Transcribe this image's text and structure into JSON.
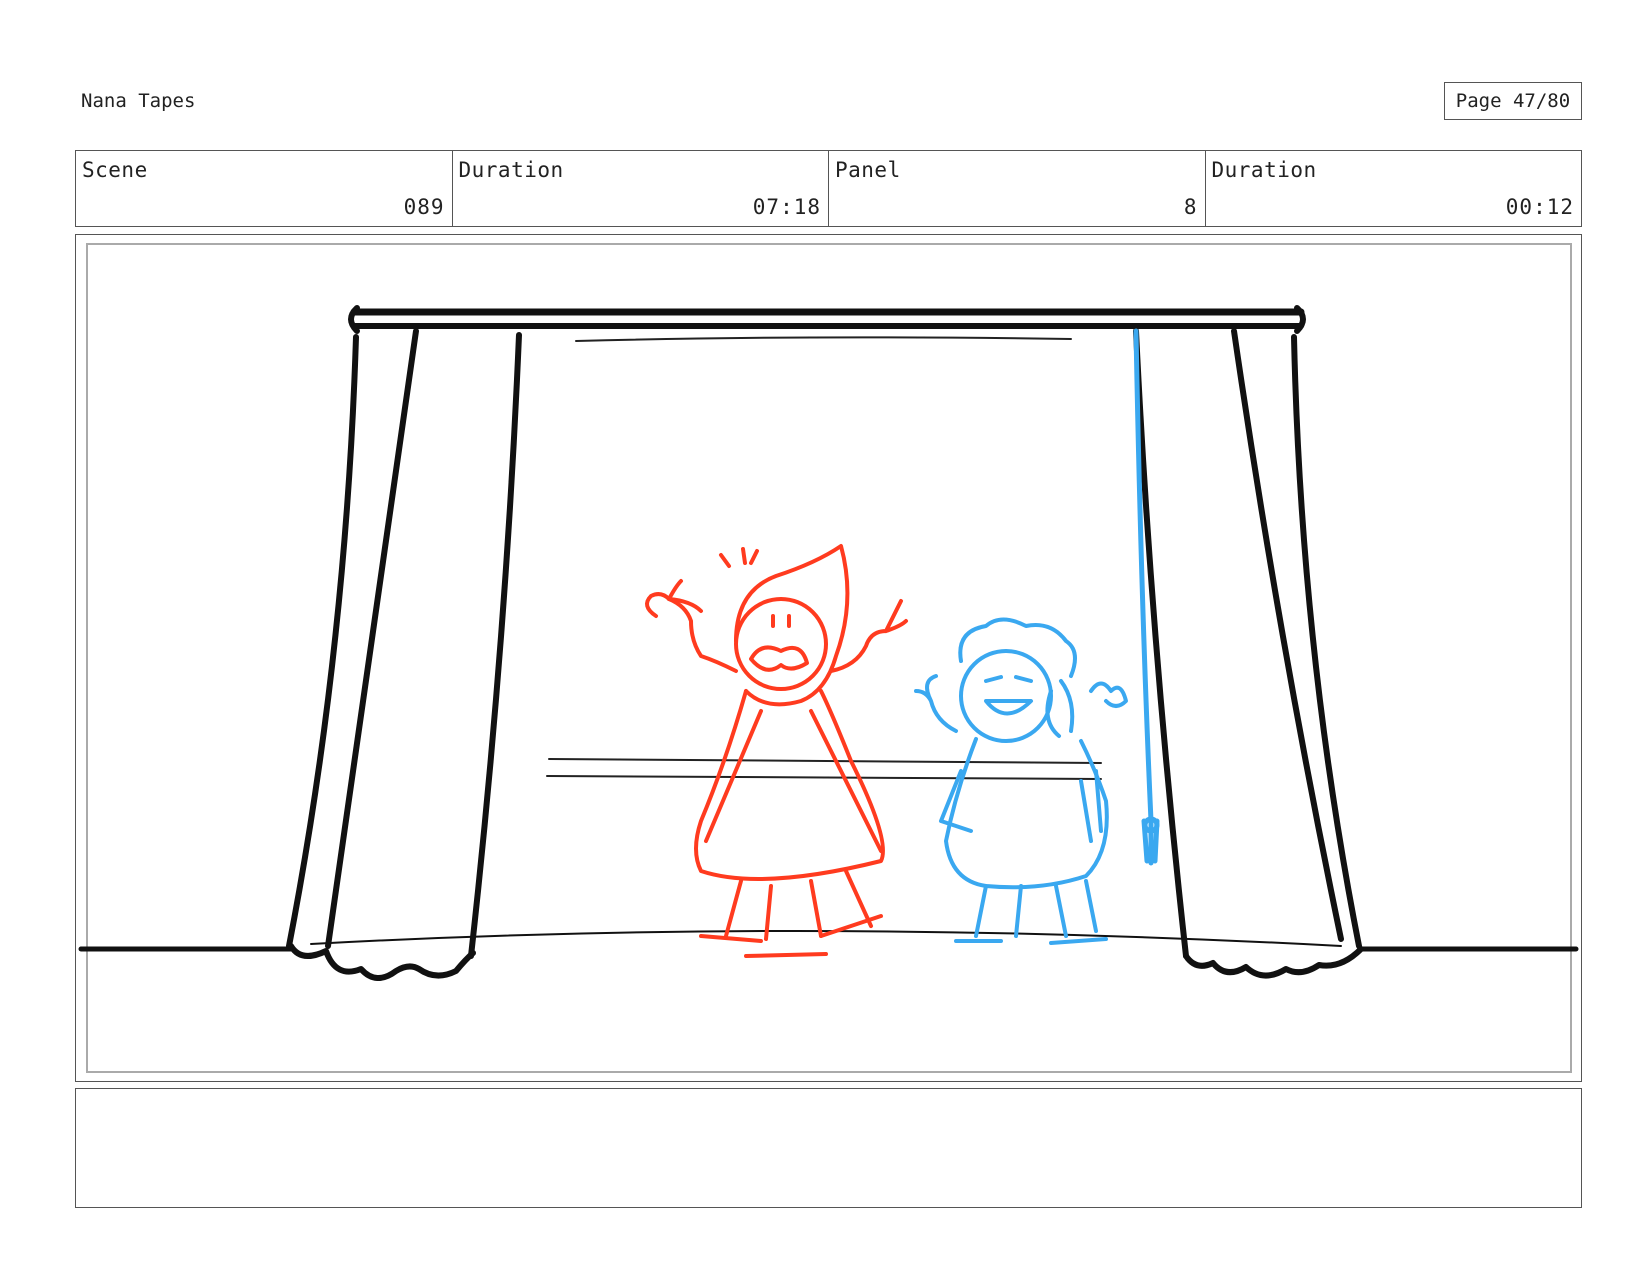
{
  "header": {
    "project_title": "Nana Tapes",
    "page_label": "Page 47/80"
  },
  "info": {
    "scene_label": "Scene",
    "scene_value": "089",
    "scene_duration_label": "Duration",
    "scene_duration_value": "07:18",
    "panel_label": "Panel",
    "panel_value": "8",
    "panel_duration_label": "Duration",
    "panel_duration_value": "00:12"
  },
  "notes": {
    "text": ""
  },
  "colors": {
    "ink": "#111111",
    "red_character": "#ff3b1f",
    "blue_character": "#3aa8f0"
  }
}
